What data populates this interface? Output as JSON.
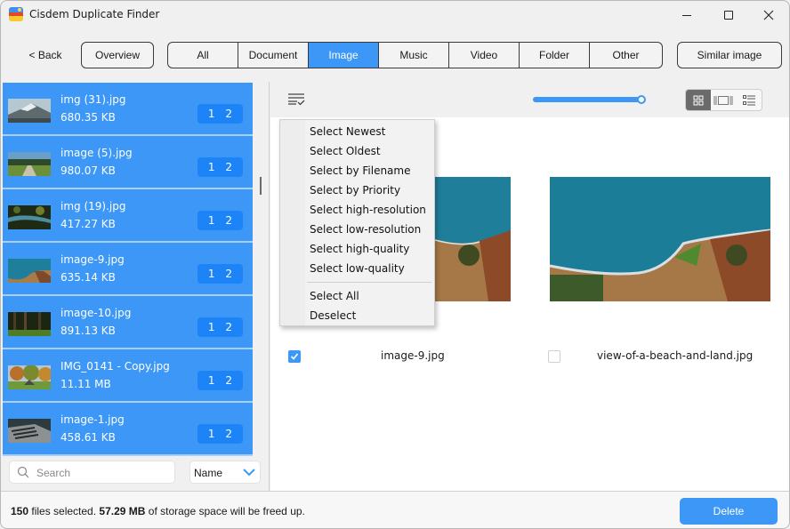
{
  "window": {
    "title": "Cisdem Duplicate Finder"
  },
  "toolbar": {
    "back_label": "< Back",
    "overview_label": "Overview",
    "similar_label": "Similar image",
    "tabs": [
      {
        "label": "All",
        "active": false
      },
      {
        "label": "Document",
        "active": false
      },
      {
        "label": "Image",
        "active": true
      },
      {
        "label": "Music",
        "active": false
      },
      {
        "label": "Video",
        "active": false
      },
      {
        "label": "Folder",
        "active": false
      },
      {
        "label": "Other",
        "active": false
      }
    ]
  },
  "file_list": {
    "items": [
      {
        "name": "img (31).jpg",
        "size": "680.35 KB",
        "badge_a": "1",
        "badge_b": "2",
        "thumb": "mountain"
      },
      {
        "name": "image (5).jpg",
        "size": "980.07 KB",
        "badge_a": "1",
        "badge_b": "2",
        "thumb": "path"
      },
      {
        "name": "img (19).jpg",
        "size": "417.27 KB",
        "badge_a": "1",
        "badge_b": "2",
        "thumb": "creek"
      },
      {
        "name": "image-9.jpg",
        "size": "635.14 KB",
        "badge_a": "1",
        "badge_b": "2",
        "thumb": "coast"
      },
      {
        "name": "image-10.jpg",
        "size": "891.13 KB",
        "badge_a": "1",
        "badge_b": "2",
        "thumb": "forest"
      },
      {
        "name": "IMG_0141 - Copy.jpg",
        "size": "11.11 MB",
        "badge_a": "1",
        "badge_b": "2",
        "thumb": "park"
      },
      {
        "name": "image-1.jpg",
        "size": "458.61 KB",
        "badge_a": "1",
        "badge_b": "2",
        "thumb": "typewriter"
      }
    ],
    "search_placeholder": "Search",
    "sort_value": "Name"
  },
  "viewer": {
    "slider_value_percent": 100,
    "view_modes": [
      "grid-view",
      "carousel-view",
      "list-view"
    ],
    "active_view": "grid-view",
    "files": [
      {
        "name": "image-9.jpg",
        "checked": true
      },
      {
        "name": "view-of-a-beach-and-land.jpg",
        "checked": false
      }
    ]
  },
  "select_menu": {
    "items": [
      "Select Newest",
      "Select Oldest",
      "Select by Filename",
      "Select by Priority",
      "Select high-resolution",
      "Select low-resolution",
      "Select high-quality",
      "Select low-quality"
    ],
    "items2": [
      "Select All",
      "Deselect"
    ]
  },
  "footer": {
    "count": "150",
    "count_text": " files selected. ",
    "size": "57.29 MB",
    "size_text": " of storage space will be freed up.",
    "delete_label": "Delete"
  },
  "colors": {
    "accent": "#3c97f6",
    "badge": "#1c84f7"
  }
}
